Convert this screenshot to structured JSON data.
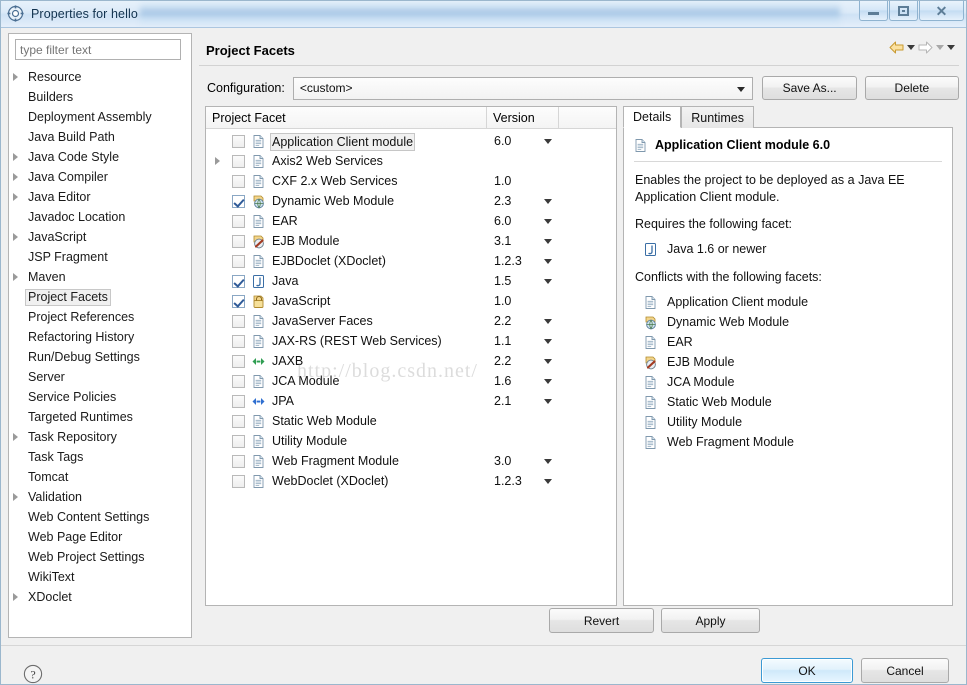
{
  "window": {
    "title": "Properties for hello",
    "icon": "properties-gear-icon",
    "controls": {
      "minimize": "Minimize",
      "maximize": "Restore",
      "close": "Close"
    }
  },
  "sidebar": {
    "filter": {
      "placeholder": "type filter text",
      "value": ""
    },
    "items": [
      {
        "label": "Resource",
        "expandable": true,
        "selected": false
      },
      {
        "label": "Builders",
        "expandable": false,
        "selected": false
      },
      {
        "label": "Deployment Assembly",
        "expandable": false,
        "selected": false
      },
      {
        "label": "Java Build Path",
        "expandable": false,
        "selected": false
      },
      {
        "label": "Java Code Style",
        "expandable": true,
        "selected": false
      },
      {
        "label": "Java Compiler",
        "expandable": true,
        "selected": false
      },
      {
        "label": "Java Editor",
        "expandable": true,
        "selected": false
      },
      {
        "label": "Javadoc Location",
        "expandable": false,
        "selected": false
      },
      {
        "label": "JavaScript",
        "expandable": true,
        "selected": false
      },
      {
        "label": "JSP Fragment",
        "expandable": false,
        "selected": false
      },
      {
        "label": "Maven",
        "expandable": true,
        "selected": false
      },
      {
        "label": "Project Facets",
        "expandable": false,
        "selected": true
      },
      {
        "label": "Project References",
        "expandable": false,
        "selected": false
      },
      {
        "label": "Refactoring History",
        "expandable": false,
        "selected": false
      },
      {
        "label": "Run/Debug Settings",
        "expandable": false,
        "selected": false
      },
      {
        "label": "Server",
        "expandable": false,
        "selected": false
      },
      {
        "label": "Service Policies",
        "expandable": false,
        "selected": false
      },
      {
        "label": "Targeted Runtimes",
        "expandable": false,
        "selected": false
      },
      {
        "label": "Task Repository",
        "expandable": true,
        "selected": false
      },
      {
        "label": "Task Tags",
        "expandable": false,
        "selected": false
      },
      {
        "label": "Tomcat",
        "expandable": false,
        "selected": false
      },
      {
        "label": "Validation",
        "expandable": true,
        "selected": false
      },
      {
        "label": "Web Content Settings",
        "expandable": false,
        "selected": false
      },
      {
        "label": "Web Page Editor",
        "expandable": false,
        "selected": false
      },
      {
        "label": "Web Project Settings",
        "expandable": false,
        "selected": false
      },
      {
        "label": "WikiText",
        "expandable": false,
        "selected": false
      },
      {
        "label": "XDoclet",
        "expandable": true,
        "selected": false
      }
    ]
  },
  "page": {
    "title": "Project Facets",
    "nav": {
      "back_icon": "arrow-left-icon",
      "forward_icon": "arrow-right-icon",
      "menu_icon": "chevron-down-icon"
    }
  },
  "configuration": {
    "label": "Configuration:",
    "value": "<custom>",
    "save_as_label": "Save As...",
    "delete_label": "Delete"
  },
  "facet_table": {
    "columns": [
      "Project Facet",
      "Version",
      ""
    ],
    "rows": [
      {
        "name": "Application Client module",
        "version": "6.0",
        "checked": false,
        "expandable": false,
        "has_version_menu": true,
        "icon": "doc-icon",
        "highlight": true
      },
      {
        "name": "Axis2 Web Services",
        "version": "",
        "checked": false,
        "expandable": true,
        "has_version_menu": false,
        "icon": "doc-icon",
        "highlight": false
      },
      {
        "name": "CXF 2.x Web Services",
        "version": "1.0",
        "checked": false,
        "expandable": false,
        "has_version_menu": false,
        "icon": "doc-icon",
        "highlight": false
      },
      {
        "name": "Dynamic Web Module",
        "version": "2.3",
        "checked": true,
        "expandable": false,
        "has_version_menu": true,
        "icon": "web-module-icon",
        "highlight": false
      },
      {
        "name": "EAR",
        "version": "6.0",
        "checked": false,
        "expandable": false,
        "has_version_menu": true,
        "icon": "doc-icon",
        "highlight": false
      },
      {
        "name": "EJB Module",
        "version": "3.1",
        "checked": false,
        "expandable": false,
        "has_version_menu": true,
        "icon": "ejb-icon",
        "highlight": false
      },
      {
        "name": "EJBDoclet (XDoclet)",
        "version": "1.2.3",
        "checked": false,
        "expandable": false,
        "has_version_menu": true,
        "icon": "doc-icon",
        "highlight": false
      },
      {
        "name": "Java",
        "version": "1.5",
        "checked": true,
        "expandable": false,
        "has_version_menu": true,
        "icon": "java-icon",
        "highlight": false
      },
      {
        "name": "JavaScript",
        "version": "1.0",
        "checked": true,
        "expandable": false,
        "has_version_menu": false,
        "icon": "js-icon",
        "highlight": false
      },
      {
        "name": "JavaServer Faces",
        "version": "2.2",
        "checked": false,
        "expandable": false,
        "has_version_menu": true,
        "icon": "doc-icon",
        "highlight": false
      },
      {
        "name": "JAX-RS (REST Web Services)",
        "version": "1.1",
        "checked": false,
        "expandable": false,
        "has_version_menu": true,
        "icon": "doc-icon",
        "highlight": false
      },
      {
        "name": "JAXB",
        "version": "2.2",
        "checked": false,
        "expandable": false,
        "has_version_menu": true,
        "icon": "jaxb-icon",
        "highlight": false
      },
      {
        "name": "JCA Module",
        "version": "1.6",
        "checked": false,
        "expandable": false,
        "has_version_menu": true,
        "icon": "doc-icon",
        "highlight": false
      },
      {
        "name": "JPA",
        "version": "2.1",
        "checked": false,
        "expandable": false,
        "has_version_menu": true,
        "icon": "jpa-icon",
        "highlight": false
      },
      {
        "name": "Static Web Module",
        "version": "",
        "checked": false,
        "expandable": false,
        "has_version_menu": false,
        "icon": "doc-icon",
        "highlight": false
      },
      {
        "name": "Utility Module",
        "version": "",
        "checked": false,
        "expandable": false,
        "has_version_menu": false,
        "icon": "doc-icon",
        "highlight": false
      },
      {
        "name": "Web Fragment Module",
        "version": "3.0",
        "checked": false,
        "expandable": false,
        "has_version_menu": true,
        "icon": "doc-icon",
        "highlight": false
      },
      {
        "name": "WebDoclet (XDoclet)",
        "version": "1.2.3",
        "checked": false,
        "expandable": false,
        "has_version_menu": true,
        "icon": "doc-icon",
        "highlight": false
      }
    ]
  },
  "details": {
    "tabs": [
      {
        "label": "Details",
        "active": true
      },
      {
        "label": "Runtimes",
        "active": false
      }
    ],
    "title": "Application Client module 6.0",
    "title_icon": "doc-icon",
    "description": "Enables the project to be deployed as a Java EE Application Client module.",
    "requires_heading": "Requires the following facet:",
    "requires": [
      {
        "label": "Java 1.6 or newer",
        "icon": "java-icon"
      }
    ],
    "conflicts_heading": "Conflicts with the following facets:",
    "conflicts": [
      {
        "label": "Application Client module",
        "icon": "doc-icon"
      },
      {
        "label": "Dynamic Web Module",
        "icon": "web-module-icon"
      },
      {
        "label": "EAR",
        "icon": "doc-icon"
      },
      {
        "label": "EJB Module",
        "icon": "ejb-icon"
      },
      {
        "label": "JCA Module",
        "icon": "doc-icon"
      },
      {
        "label": "Static Web Module",
        "icon": "doc-icon"
      },
      {
        "label": "Utility Module",
        "icon": "doc-icon"
      },
      {
        "label": "Web Fragment Module",
        "icon": "doc-icon"
      }
    ]
  },
  "footer": {
    "revert_label": "Revert",
    "apply_label": "Apply",
    "ok_label": "OK",
    "cancel_label": "Cancel",
    "help_icon": "help-question-icon"
  },
  "watermark": {
    "text": "http://blog.csdn.net/"
  },
  "colors": {
    "titlebar_accent": "#cfe2f5",
    "selection_border": "#c8c8c8",
    "default_button_border": "#3c9ad4",
    "checkbox_check": "#2f5b99"
  }
}
